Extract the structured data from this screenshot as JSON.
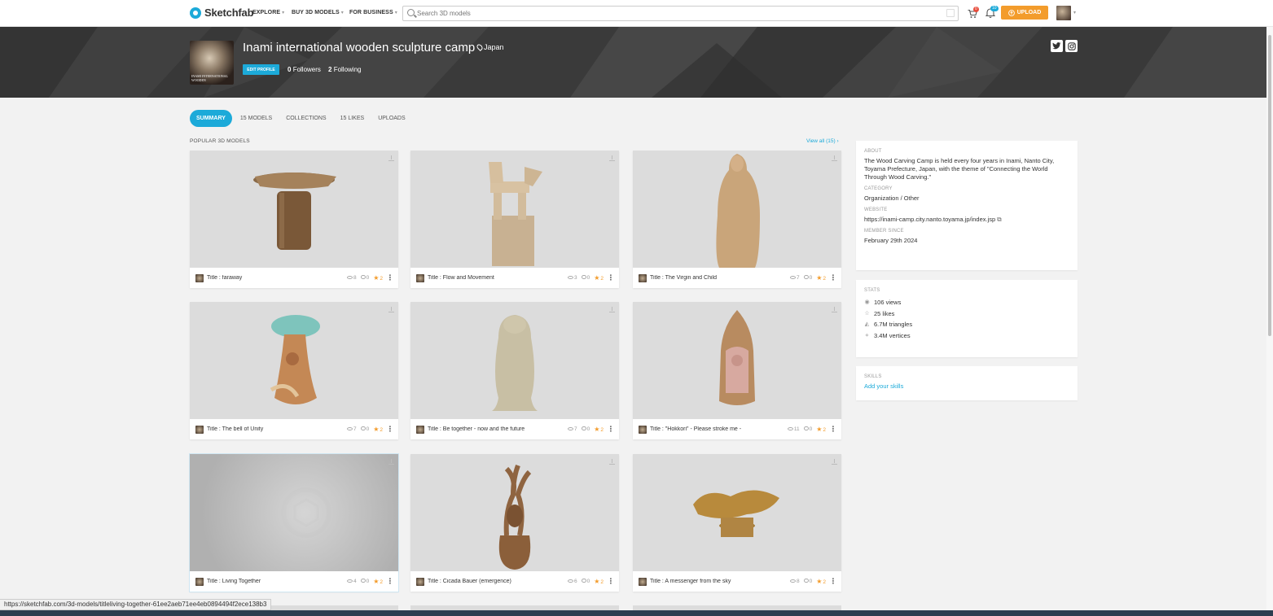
{
  "nav": {
    "logo": "Sketchfab",
    "links": [
      "EXPLORE",
      "BUY 3D MODELS",
      "FOR BUSINESS"
    ],
    "search_placeholder": "Search 3D models",
    "cart_badge": "0",
    "notif_badge": "10",
    "upload": "UPLOAD"
  },
  "profile": {
    "name": "Inami international wooden sculpture camp",
    "location": "Japan",
    "edit": "EDIT PROFILE",
    "followers_count": "0",
    "followers_label": "Followers",
    "following_count": "2",
    "following_label": "Following",
    "pic_caption": "INAMI INTERNATIONAL WOODEN"
  },
  "tabs": [
    "SUMMARY",
    "15 MODELS",
    "COLLECTIONS",
    "15 LIKES",
    "UPLOADS"
  ],
  "section": {
    "title": "POPULAR 3D MODELS",
    "view_all": "View all (15)"
  },
  "models": [
    {
      "title": "Title : faraway",
      "views": "8",
      "comments": "0",
      "likes": "2",
      "icon": "table-sculpture"
    },
    {
      "title": "Title : Flow and Movement",
      "views": "3",
      "comments": "0",
      "likes": "2",
      "icon": "horse-sculpture"
    },
    {
      "title": "Title : The Virgin and Child",
      "views": "7",
      "comments": "0",
      "likes": "2",
      "icon": "virgin-statue"
    },
    {
      "title": "Title : The bell of Unity",
      "views": "7",
      "comments": "0",
      "likes": "2",
      "icon": "tree-bell"
    },
    {
      "title": "Title : Be together - now and the future",
      "views": "7",
      "comments": "0",
      "likes": "2",
      "icon": "seal-statue"
    },
    {
      "title": "Title : \"Hokkori\" - Please stroke me -",
      "views": "11",
      "comments": "0",
      "likes": "2",
      "icon": "buddha-shrine"
    },
    {
      "title": "Title : Living Together",
      "views": "4",
      "comments": "0",
      "likes": "2",
      "icon": "placeholder-cube"
    },
    {
      "title": "Title : Cicada Bauer (emergence)",
      "views": "6",
      "comments": "0",
      "likes": "2",
      "icon": "cicada-root"
    },
    {
      "title": "Title : A messenger from the sky",
      "views": "8",
      "comments": "0",
      "likes": "2",
      "icon": "dragon-sculpture"
    }
  ],
  "about": {
    "label": "ABOUT",
    "text": "The Wood Carving Camp is held every four years in Inami, Nanto City, Toyama Prefecture, Japan, with the theme of \"Connecting the World Through Wood Carving.\"",
    "category_label": "CATEGORY",
    "category": "Organization / Other",
    "website_label": "WEBSITE",
    "website": "https://inami-camp.city.nanto.toyama.jp/index.jsp",
    "member_label": "MEMBER SINCE",
    "member_since": "February 29th 2024"
  },
  "stats": {
    "label": "STATS",
    "views": "106 views",
    "likes": "25 likes",
    "triangles": "6.7M triangles",
    "vertices": "3.4M vertices"
  },
  "skills": {
    "label": "SKILLS",
    "add": "Add your skills"
  },
  "status_url": "https://sketchfab.com/3d-models/titleliving-together-61ee2aeb71ee4eb0894494f2ece138b3",
  "colors": {
    "accent": "#1caad9",
    "upload": "#f39c2c",
    "banner": "#3b3b3b"
  }
}
